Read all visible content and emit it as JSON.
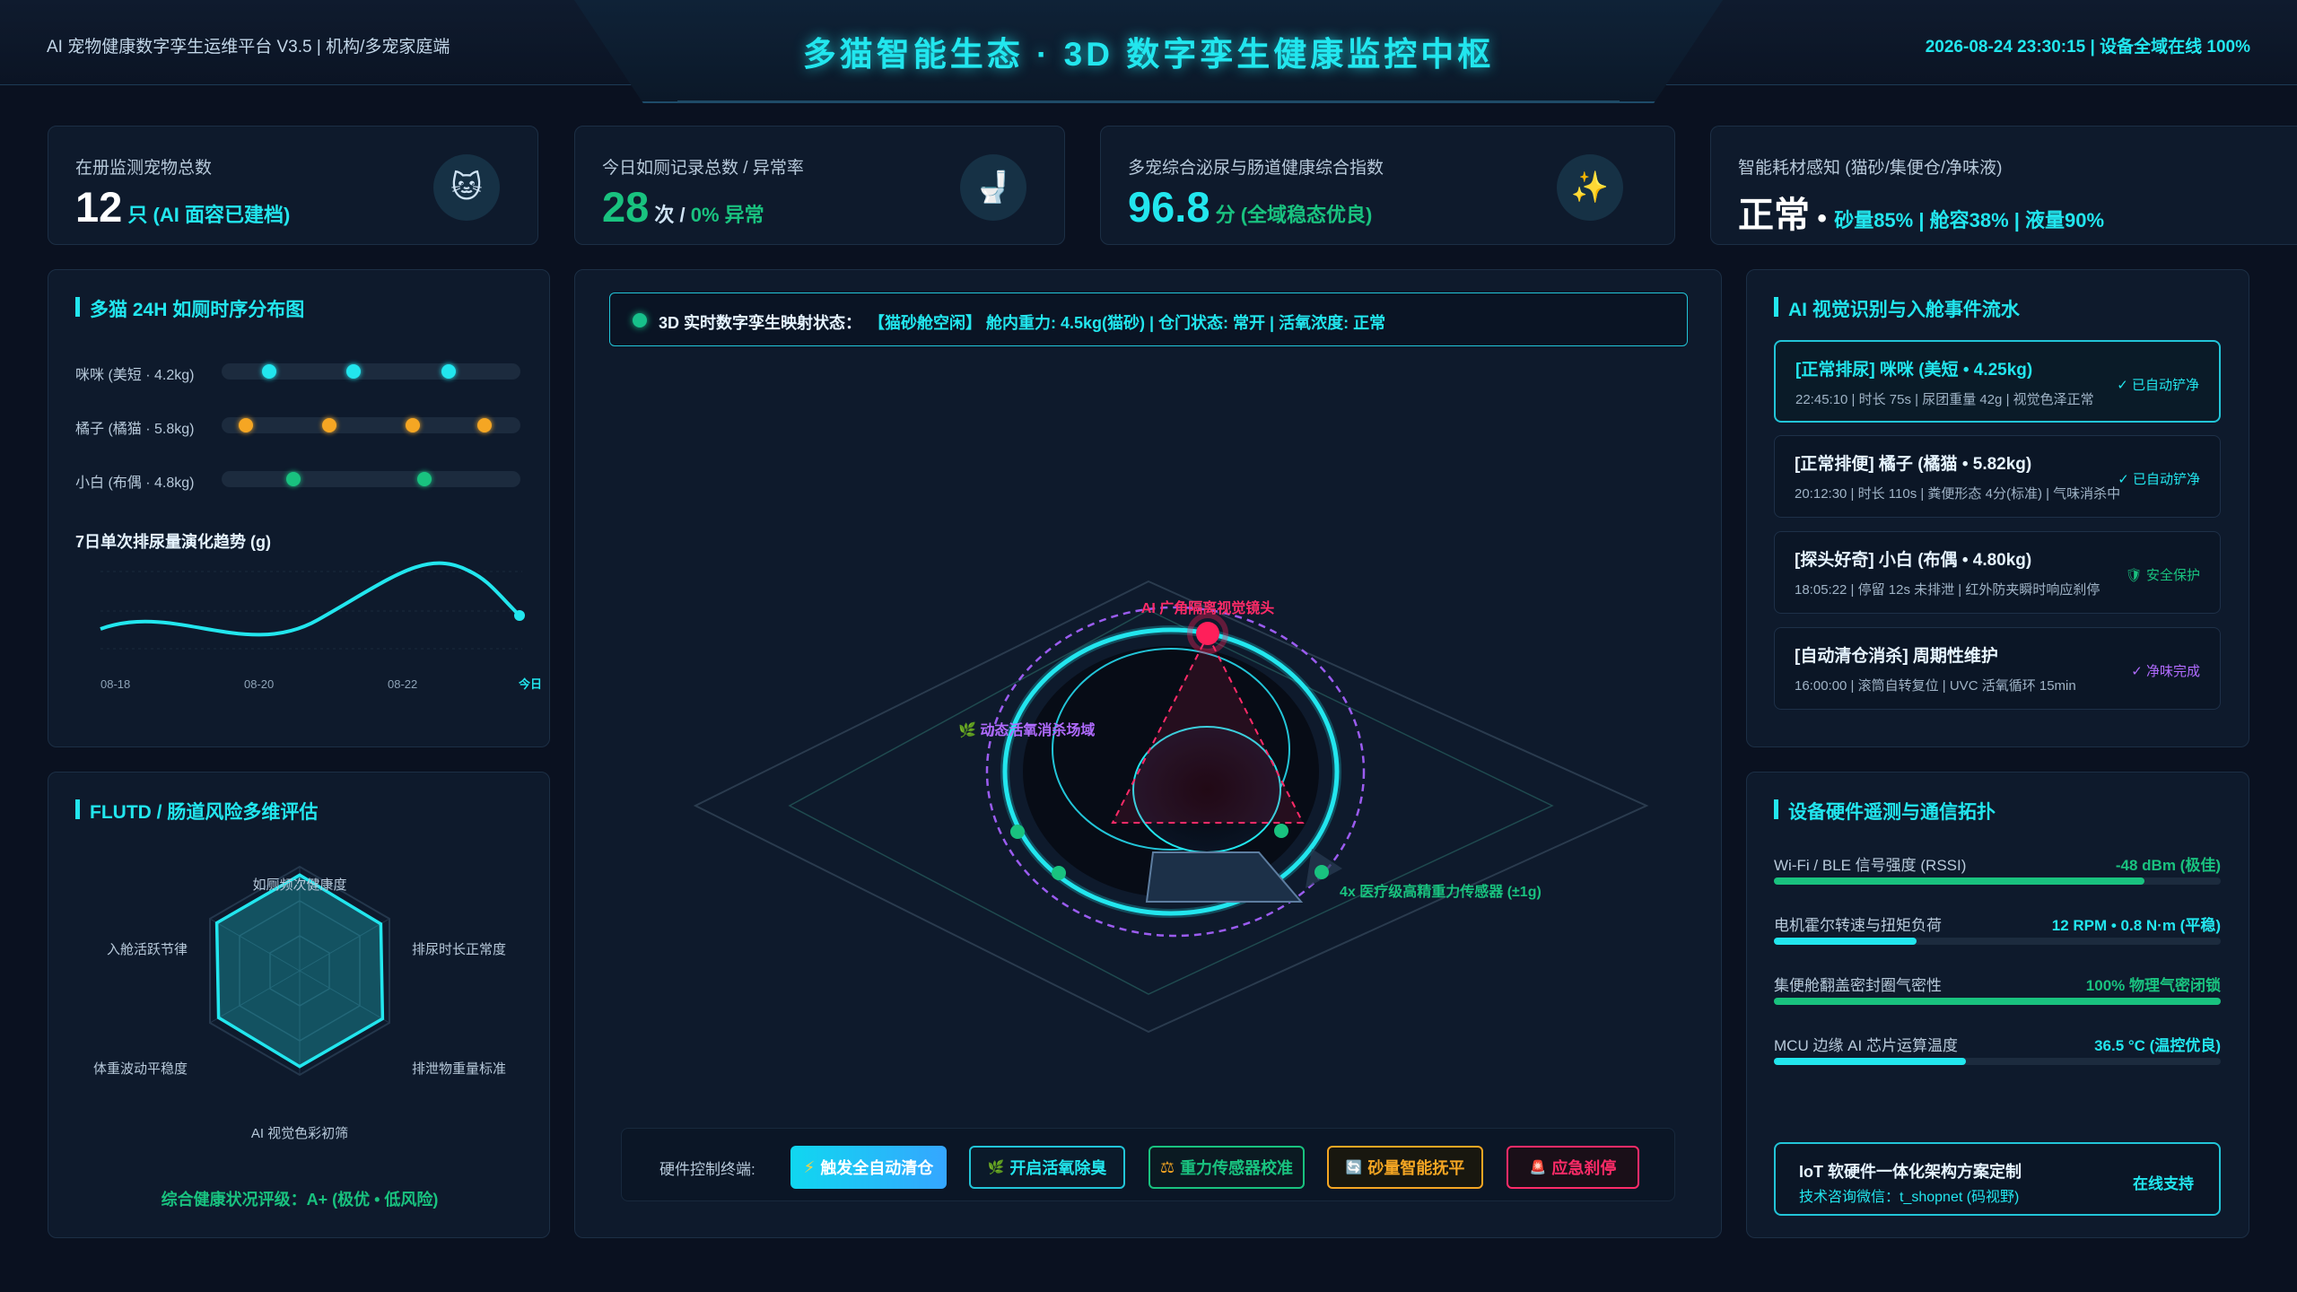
{
  "header": {
    "left": "AI 宠物健康数字孪生运维平台 V3.5 | 机构/多宠家庭端",
    "title": "多猫智能生态 · 3D 数字孪生健康监控中枢",
    "right": "2026-08-24 23:30:15 | 设备全域在线 100%"
  },
  "kpis": [
    {
      "label": "在册监测宠物总数",
      "value": "12",
      "unit": " 只 (AI 面容已建档)",
      "icon": "cat-face-icon",
      "color": "#22e6ee"
    },
    {
      "label": "今日如厕记录总数 / 异常率",
      "value": "28",
      "unit_pre": " 次 / ",
      "value2": "0%",
      "unit": " 异常",
      "icon": "toilet-icon",
      "color": "#19c27f"
    },
    {
      "label": "多宠综合泌尿与肠道健康综合指数",
      "value": "96.8",
      "unit": " 分 (全域稳态优良)",
      "icon": "sparkles-icon",
      "color": "#22e6ee"
    },
    {
      "label": "智能耗材感知 (猫砂/集便仓/净味液)",
      "value": "正常",
      "sep": " • ",
      "unit": "砂量85% | 舱容38% | 液量90%",
      "icon": "",
      "color": "#ffffff"
    }
  ],
  "timeline": {
    "title": "多猫 24H 如厕时序分布图",
    "rows": [
      {
        "name": "咪咪 (美短 · 4.2kg)",
        "color": "#22e6ee",
        "points": [
          0.16,
          0.44,
          0.76
        ]
      },
      {
        "name": "橘子 (橘猫 · 5.8kg)",
        "color": "#f5a623",
        "points": [
          0.08,
          0.36,
          0.64,
          0.88
        ]
      },
      {
        "name": "小白 (布偶 · 4.8kg)",
        "color": "#19c27f",
        "points": [
          0.24,
          0.68
        ]
      }
    ]
  },
  "trend": {
    "title": "7日单次排尿量演化趋势 (g)",
    "x_labels": [
      "08-18",
      "08-20",
      "08-22",
      "今日"
    ]
  },
  "radar": {
    "title": "FLUTD / 肠道风险多维评估",
    "axes": [
      "如厕频次健康度",
      "排尿时长正常度",
      "排泄物重量标准",
      "AI 视觉色彩初筛",
      "体重波动平稳度",
      "入舱活跃节律"
    ],
    "values": [
      0.92,
      0.9,
      0.92,
      0.92,
      0.9,
      0.92
    ],
    "footer": "综合健康状况评级：A+ (极优 • 低风险)"
  },
  "scene": {
    "status_label": "3D 实时数字孪生映射状态：",
    "status_value": "【猫砂舱空闲】 舱内重力: 4.5kg(猫砂) | 仓门状态: 常开 | 活氧浓度: 正常",
    "camera_label": "AI 广角隔离视觉镜头",
    "oxygen_label": "🌿 动态活氧消杀场域",
    "sensor_label": "4x 医疗级高精重力传感器 (±1g)"
  },
  "controls": {
    "label": "硬件控制终端:",
    "buttons": [
      {
        "label": "触发全自动清仓",
        "icon": "⚡"
      },
      {
        "label": "开启活氧除臭",
        "icon": "🌿"
      },
      {
        "label": "重力传感器校准",
        "icon": "⚖"
      },
      {
        "label": "砂量智能抚平",
        "icon": "🔄"
      },
      {
        "label": "应急刹停",
        "icon": "🚨"
      }
    ]
  },
  "events": {
    "title": "AI 视觉识别与入舱事件流水",
    "items": [
      {
        "title": "[正常排尿] 咪咪 (美短 • 4.25kg)",
        "sub": "22:45:10 | 时长 75s | 尿团重量 42g | 视觉色泽正常",
        "tag": "✓ 已自动铲净",
        "tag_color": "#22e6ee",
        "title_color": "#22e6ee",
        "highlight": true
      },
      {
        "title": "[正常排便] 橘子 (橘猫 • 5.82kg)",
        "sub": "20:12:30 | 时长 110s | 粪便形态 4分(标准) | 气味消杀中",
        "tag": "✓ 已自动铲净",
        "tag_color": "#22e6ee",
        "title_color": "#e6f4ff",
        "highlight": false
      },
      {
        "title": "[探头好奇] 小白 (布偶 • 4.80kg)",
        "sub": "18:05:22 | 停留 12s 未排泄 | 红外防夹瞬时响应刹停",
        "tag": "🛡 安全保护",
        "tag_color": "#19c27f",
        "title_color": "#e6f4ff",
        "highlight": false
      },
      {
        "title": "[自动清仓消杀] 周期性维护",
        "sub": "16:00:00 | 滚筒自转复位 | UVC 活氧循环 15min",
        "tag": "✓ 净味完成",
        "tag_color": "#b06bff",
        "title_color": "#e6f4ff",
        "highlight": false
      }
    ]
  },
  "hardware": {
    "title": "设备硬件遥测与通信拓扑",
    "rows": [
      {
        "label": "Wi-Fi / BLE 信号强度 (RSSI)",
        "value": "-48 dBm (极佳)",
        "level": 0.83,
        "color": "#19c27f"
      },
      {
        "label": "电机霍尔转速与扭矩负荷",
        "value": "12 RPM • 0.8 N·m (平稳)",
        "level": 0.32,
        "color": "#22e6ee"
      },
      {
        "label": "集便舱翻盖密封圈气密性",
        "value": "100% 物理气密闭锁",
        "level": 1.0,
        "color": "#19c27f"
      },
      {
        "label": "MCU 边缘 AI 芯片运算温度",
        "value": "36.5 °C (温控优良)",
        "level": 0.43,
        "color": "#22e6ee"
      }
    ],
    "iot_title": "IoT 软硬件一体化架构方案定制",
    "iot_contact": "技术咨询微信：t_shopnet (码视野)",
    "iot_action": "在线支持"
  }
}
